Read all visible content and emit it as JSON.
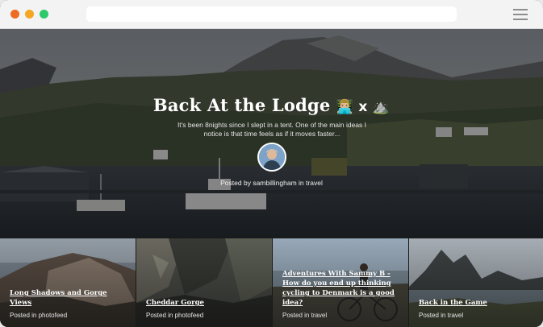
{
  "hero": {
    "title": "Back At the Lodge",
    "title_emoji": "👨🏼‍💻 x ⛰️",
    "excerpt": "It's been 8nights since I slept in a tent. One of the main ideas I notice is that time feels as if it moves faster...",
    "posted_prefix": "Posted by",
    "author": "sambillingham",
    "in_word": "in",
    "category": "travel"
  },
  "cards": [
    {
      "title": "Long Shadows and Gorge Views",
      "posted_in": "Posted in",
      "category": "photofeed"
    },
    {
      "title": "Cheddar Gorge",
      "posted_in": "Posted in",
      "category": "photofeed"
    },
    {
      "title": "Adventures With Sammy B - How do you end up thinking cycling to Denmark is a good idea?",
      "posted_in": "Posted in",
      "category": "travel"
    },
    {
      "title": "Back in the Game",
      "posted_in": "Posted in",
      "category": "travel"
    }
  ],
  "colors": {
    "close": "#ef6a22",
    "minimize": "#f5a623",
    "maximize": "#2ec96b",
    "chrome": "#f3f3f4"
  },
  "icons": {
    "menu": "hamburger-menu-icon"
  }
}
